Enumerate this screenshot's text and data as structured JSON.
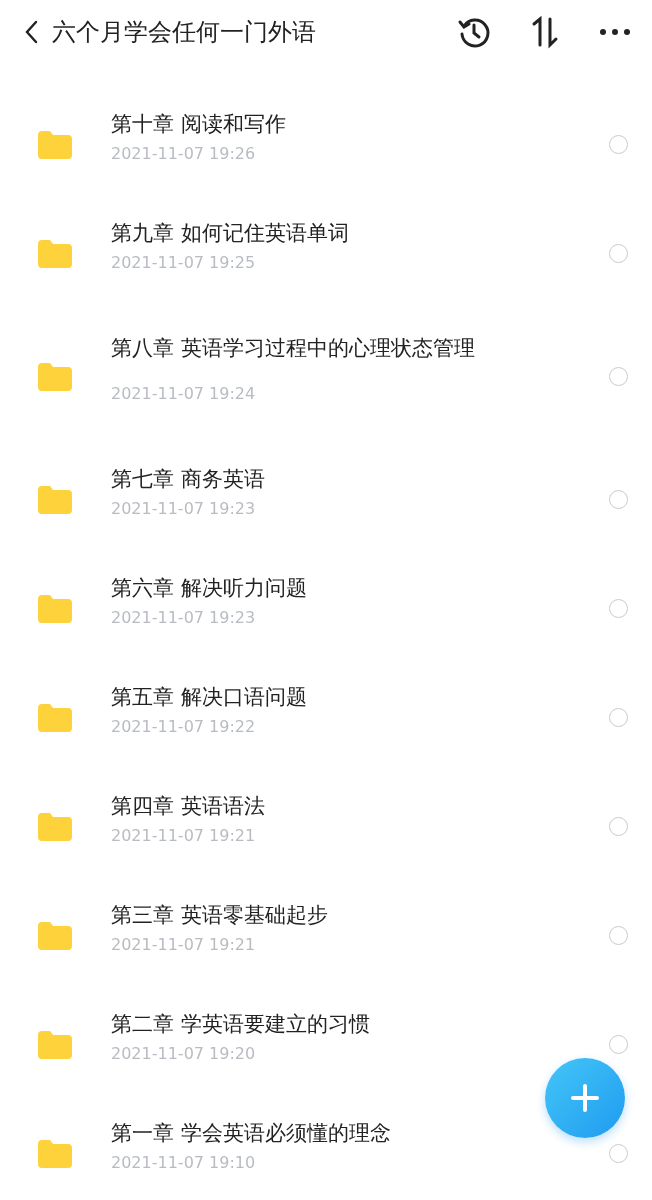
{
  "header": {
    "title": "六个月学会任何一门外语"
  },
  "files": [
    {
      "name": "第十章 阅读和写作",
      "date": "2021-11-07 19:26",
      "selected": false
    },
    {
      "name": "第九章 如何记住英语单词",
      "date": "2021-11-07 19:25",
      "selected": false
    },
    {
      "name": "第八章 英语学习过程中的心理状态管理",
      "date": "2021-11-07 19:24",
      "selected": false
    },
    {
      "name": "第七章 商务英语",
      "date": "2021-11-07 19:23",
      "selected": false
    },
    {
      "name": "第六章 解决听力问题",
      "date": "2021-11-07 19:23",
      "selected": false
    },
    {
      "name": "第五章 解决口语问题",
      "date": "2021-11-07 19:22",
      "selected": false
    },
    {
      "name": "第四章 英语语法",
      "date": "2021-11-07 19:21",
      "selected": false
    },
    {
      "name": "第三章 英语零基础起步",
      "date": "2021-11-07 19:21",
      "selected": false
    },
    {
      "name": "第二章 学英语要建立的习惯",
      "date": "2021-11-07 19:20",
      "selected": false
    },
    {
      "name": "第一章 学会英语必须懂的理念",
      "date": "2021-11-07 19:10",
      "selected": false
    }
  ]
}
